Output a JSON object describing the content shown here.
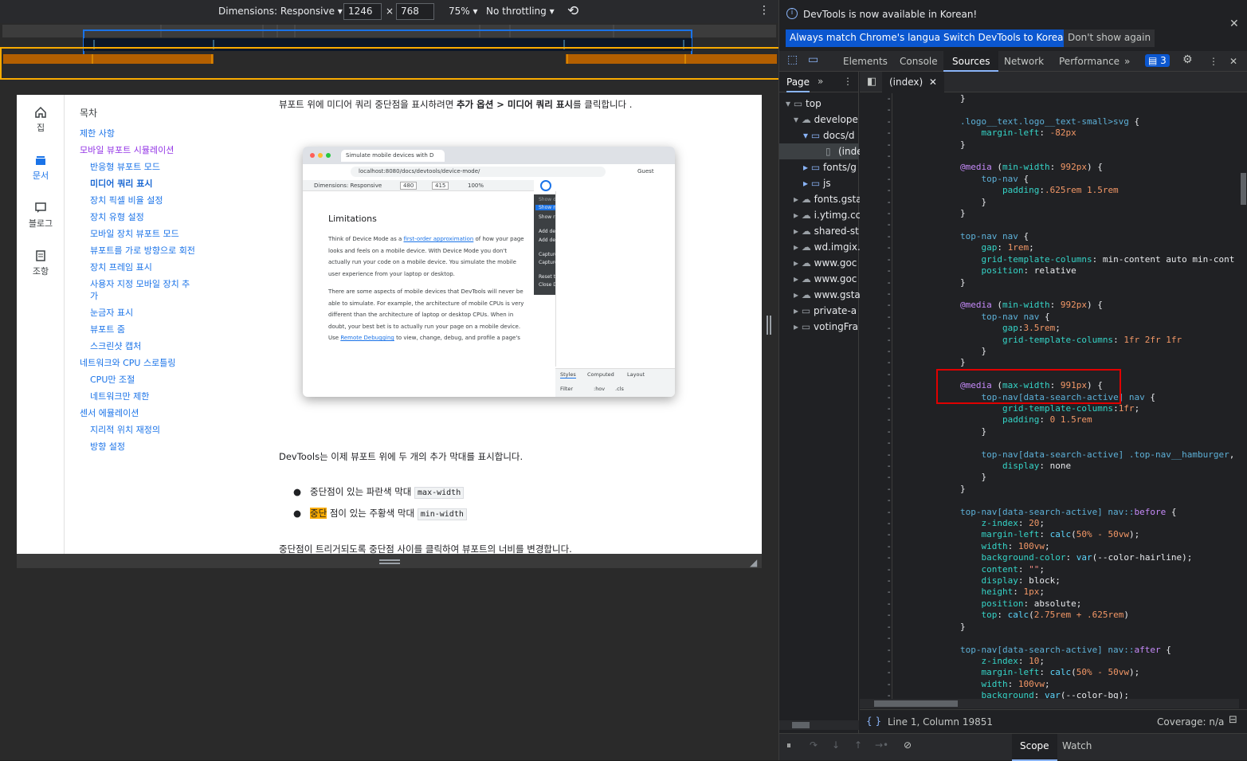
{
  "device_toolbar": {
    "dimensions_label": "Dimensions: Responsive",
    "width": "1246",
    "height": "768",
    "times": "×",
    "zoom": "75%",
    "throttling": "No throttling"
  },
  "page": {
    "nav": [
      {
        "label": "집"
      },
      {
        "label": "문서"
      },
      {
        "label": "블로그"
      },
      {
        "label": "조항"
      }
    ],
    "toc_title": "목차",
    "toc": [
      {
        "label": "제한 사항"
      },
      {
        "label": "모바일 뷰포트 시뮬레이션"
      },
      {
        "label": "반응형 뷰포트 모드"
      },
      {
        "label": "미디어 쿼리 표시"
      },
      {
        "label": "장치 픽셀 비율 설정"
      },
      {
        "label": "장치 유형 설정"
      },
      {
        "label": "모바일 장치 뷰포트 모드"
      },
      {
        "label": "뷰포트를 가로 방향으로 회전"
      },
      {
        "label": "장치 프레임 표시"
      },
      {
        "label": "사용자 지정 모바일 장치 추"
      },
      {
        "label": "가"
      },
      {
        "label": "눈금자 표시"
      },
      {
        "label": "뷰포트 줌"
      },
      {
        "label": "스크린샷 캡처"
      },
      {
        "label": "네트워크와 CPU 스로틀링"
      },
      {
        "label": "CPU만 조절"
      },
      {
        "label": "네트워크만 제한"
      },
      {
        "label": "센서 에뮬레이션"
      },
      {
        "label": "지리적 위치 재정의"
      },
      {
        "label": "방향 설정"
      }
    ],
    "intro": "뷰포트 위에 미디어 쿼리 중단점을 표시하려면",
    "intro_path": "추가 옵션 > 미디어 쿼리 표시",
    "intro_end": "를 클릭합니다 .",
    "figure": {
      "tab_title": "Simulate mobile devices with D",
      "url": "localhost:8080/docs/devtools/device-mode/",
      "guest": "Guest",
      "dim": "Dimensions: Responsive",
      "w": "480",
      "h": "415",
      "zoom": "100%",
      "menu": [
        "Show device frame",
        "Show media queries",
        "Show rulers",
        "Add device pixel ratio",
        "Add device type",
        "Capture screenshot",
        "Capture full size screenshot",
        "Reset to defaults",
        "Close DevTools"
      ],
      "heading": "Limitations",
      "p1_a": "Think of Device Mode as a ",
      "p1_link": "first-order approximation",
      "p1_b": " of how your page looks and feels on a mobile device. With Device Mode you don't actually run your code on a mobile device. You simulate the mobile user experience from your laptop or desktop.",
      "p2": "There are some aspects of mobile devices that DevTools will never be able to simulate. For example, the architecture of mobile CPUs is very different than the architecture of laptop or desktop CPUs. When in doubt, your best bet is to actually run your page on a mobile device. Use ",
      "p2_link": "Remote Debugging",
      "p2_b": " to view, change, debug, and profile a page's",
      "panel_tabs": [
        "Styles",
        "Computed",
        "Layout"
      ],
      "filter": "Filter",
      "hov": ":hov",
      "cls": ".cls"
    },
    "after": "DevTools는 이제 뷰포트 위에 두 개의 추가 막대를 표시합니다.",
    "bullet1": "중단점이 있는 파란색 막대",
    "bullet1_code": "max-width",
    "bullet2_hl": "중단",
    "bullet2": "점이 있는 주황색 막대",
    "bullet2_code": "min-width",
    "last": "중단점이 트리거되도록 중단점 사이를 클릭하여 뷰포트의 너비를 변경합니다."
  },
  "devtools": {
    "banner": "DevTools is now available in Korean!",
    "btn_match": "Always match Chrome's language",
    "btn_switch": "Switch DevTools to Korean",
    "btn_dont": "Don't show again",
    "tabs": [
      "Elements",
      "Console",
      "Sources",
      "Network",
      "Performance"
    ],
    "issues_count": "3",
    "page_tab": "Page",
    "file_tab": "(index)",
    "tree": [
      "top",
      "develope",
      "docs/d",
      "(inde",
      "fonts/g",
      "js",
      "fonts.gsta",
      "i.ytimg.cc",
      "shared-st",
      "wd.imgix.",
      "www.goc",
      "www.goc",
      "www.gsta",
      "private-a",
      "votingFra"
    ],
    "status_pos": "Line 1, Column 19851",
    "coverage": "Coverage: n/a",
    "bottom_tabs": [
      "Scope",
      "Watch"
    ]
  },
  "colors": {
    "accent": "#1a73e8",
    "highlight_box": "#e00000",
    "mq_blue": "#1a73e8",
    "mq_orange": "#f9ab00"
  }
}
